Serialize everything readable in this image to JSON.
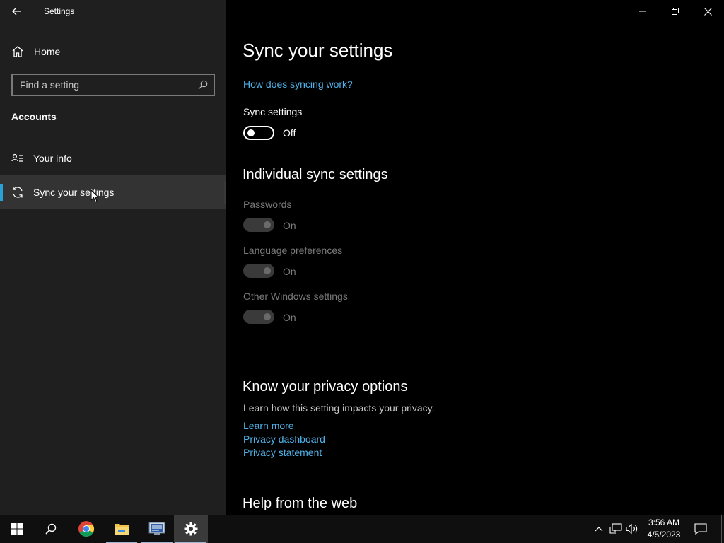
{
  "window": {
    "app_title": "Settings"
  },
  "sidebar": {
    "home_label": "Home",
    "search_placeholder": "Find a setting",
    "section_heading": "Accounts",
    "items": [
      {
        "label": "Your info",
        "icon": "person-card-icon",
        "selected": false
      },
      {
        "label": "Sync your settings",
        "icon": "sync-icon",
        "selected": true
      }
    ]
  },
  "main": {
    "title": "Sync your settings",
    "how_link": "How does syncing work?",
    "sync_settings": {
      "label": "Sync settings",
      "state": "Off"
    },
    "individual_heading": "Individual sync settings",
    "individual": [
      {
        "label": "Passwords",
        "state": "On"
      },
      {
        "label": "Language preferences",
        "state": "On"
      },
      {
        "label": "Other Windows settings",
        "state": "On"
      }
    ],
    "privacy": {
      "heading": "Know your privacy options",
      "text": "Learn how this setting impacts your privacy.",
      "links": [
        "Learn more",
        "Privacy dashboard",
        "Privacy statement"
      ]
    },
    "help_heading": "Help from the web"
  },
  "taskbar": {
    "time": "3:56 AM",
    "date": "4/5/2023",
    "apps": [
      "start-icon",
      "search-icon",
      "chrome-icon",
      "file-explorer-icon",
      "network-app-icon",
      "settings-gear-icon"
    ]
  },
  "colors": {
    "accent": "#2aa0d8",
    "link": "#4fb1e8",
    "sidebar_bg": "#1f1f1f",
    "main_bg": "#000000",
    "disabled_text": "#7a7a7a"
  }
}
